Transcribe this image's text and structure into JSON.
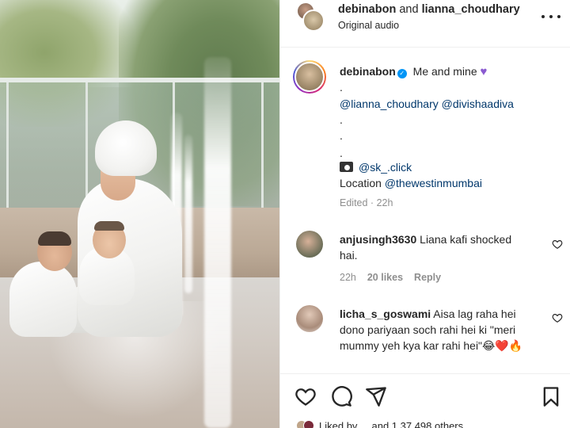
{
  "post": {
    "header": {
      "user_primary": "debinabon",
      "conjunction": "and",
      "user_secondary": "lianna_choudhary",
      "subtitle": "Original audio"
    },
    "caption": {
      "username": "debinabon",
      "text": "Me and mine",
      "lines": [
        ".",
        ".",
        "."
      ],
      "mentions": [
        "@lianna_choudhary",
        "@divishaadiva"
      ],
      "photo_credit": "@sk_.click",
      "location_label": "Location",
      "location_mention": "@thewestinmumbai",
      "edited_label": "Edited",
      "time": "22h"
    },
    "comments": [
      {
        "username": "anjusingh3630",
        "text": "Liana kafi shocked hai.",
        "time": "22h",
        "likes": "20 likes",
        "reply_label": "Reply"
      },
      {
        "username": "licha_s_goswami",
        "text": "Aisa lag raha hei dono pariyaan soch rahi hei ki \"meri mummy yeh kya kar rahi hei\"😂❤️🔥"
      }
    ],
    "likes_footer": "Liked by ... and 1,37,498 others"
  },
  "icons": {
    "more": "more-horizontal-icon",
    "verified": "verified-badge-icon",
    "like": "heart-outline-icon",
    "comment": "comment-bubble-icon",
    "share": "paper-plane-icon",
    "save": "bookmark-icon",
    "camera": "camera-icon"
  },
  "colors": {
    "text": "#262626",
    "mention": "#00376b",
    "secondary": "#8e8e8e",
    "verified": "#0095f6",
    "purple_heart": "#8a5ad0"
  }
}
